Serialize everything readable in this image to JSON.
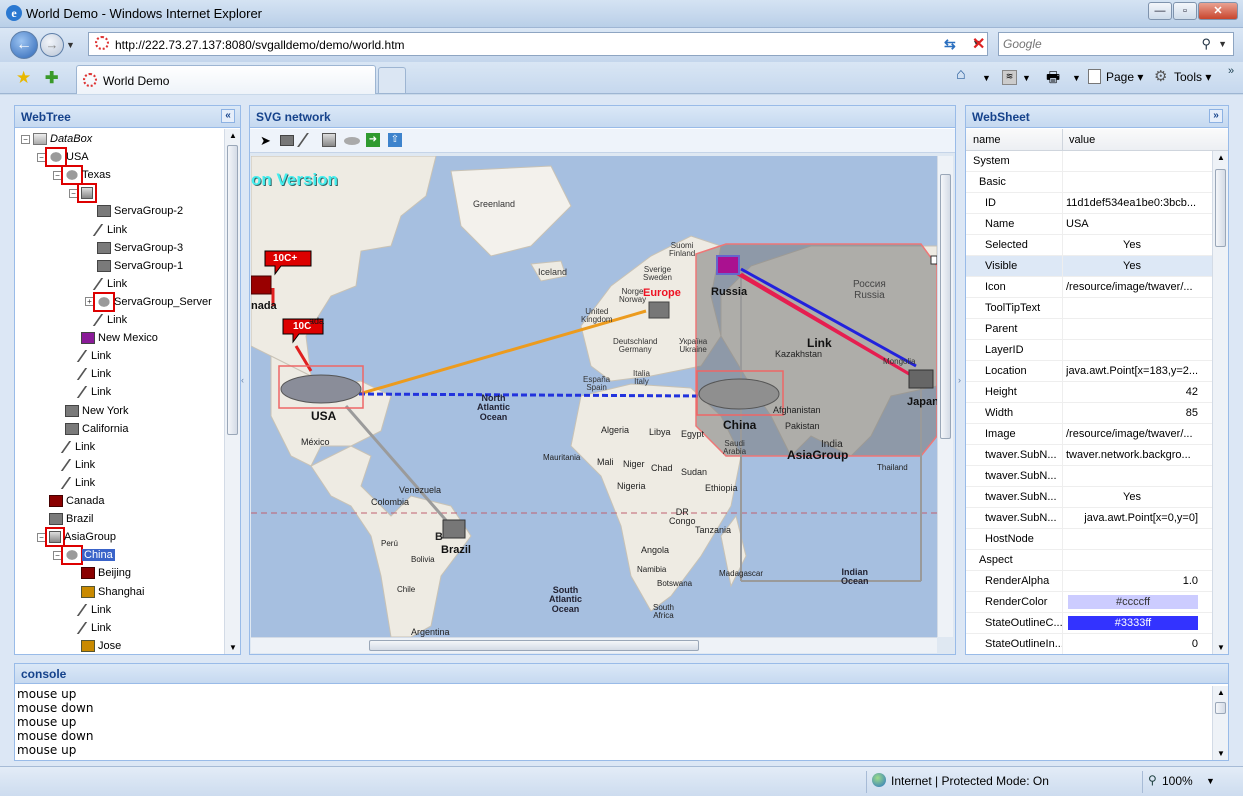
{
  "window": {
    "title": "World Demo - Windows Internet Explorer"
  },
  "nav": {
    "url": "http://222.73.27.137:8080/svgalldemo/demo/world.htm",
    "search_placeholder": "Google"
  },
  "tab": {
    "label": "World Demo"
  },
  "toolbar": {
    "page_label": "Page",
    "tools_label": "Tools"
  },
  "panels": {
    "webtree": "WebTree",
    "svg": "SVG network",
    "websheet": "WebSheet",
    "console": "console"
  },
  "tree": [
    {
      "label": "DataBox",
      "indent": 0,
      "icon": "databox-icon",
      "toggle": "−",
      "italic": true
    },
    {
      "label": "USA",
      "indent": 1,
      "icon": "cloud-icon",
      "toggle": "−",
      "red": true
    },
    {
      "label": "Texas",
      "indent": 2,
      "icon": "cloud-icon",
      "toggle": "−",
      "red": true
    },
    {
      "label": "",
      "indent": 3,
      "icon": "server-icon",
      "toggle": "−",
      "red": true
    },
    {
      "label": "ServaGroup-2",
      "indent": 4,
      "icon": "computer-icon"
    },
    {
      "label": "Link",
      "indent": 4,
      "icon": "link-icon"
    },
    {
      "label": "ServaGroup-3",
      "indent": 4,
      "icon": "computer-icon"
    },
    {
      "label": "ServaGroup-1",
      "indent": 4,
      "icon": "computer-icon"
    },
    {
      "label": "Link",
      "indent": 4,
      "icon": "link-icon"
    },
    {
      "label": "ServaGroup_Server",
      "indent": 4,
      "icon": "cloud-icon",
      "toggle": "+",
      "red": true
    },
    {
      "label": "Link",
      "indent": 4,
      "icon": "link-icon"
    },
    {
      "label": "New Mexico",
      "indent": 3,
      "icon": "purple-computer-icon"
    },
    {
      "label": "Link",
      "indent": 3,
      "icon": "link-icon"
    },
    {
      "label": "Link",
      "indent": 3,
      "icon": "link-icon"
    },
    {
      "label": "Link",
      "indent": 3,
      "icon": "link-icon"
    },
    {
      "label": "New York",
      "indent": 2,
      "icon": "computer-icon"
    },
    {
      "label": "California",
      "indent": 2,
      "icon": "computer-icon"
    },
    {
      "label": "Link",
      "indent": 2,
      "icon": "link-icon"
    },
    {
      "label": "Link",
      "indent": 2,
      "icon": "link-icon"
    },
    {
      "label": "Link",
      "indent": 2,
      "icon": "link-icon"
    },
    {
      "label": "Canada",
      "indent": 1,
      "icon": "red-computer-icon"
    },
    {
      "label": "Brazil",
      "indent": 1,
      "icon": "computer-icon"
    },
    {
      "label": "AsiaGroup",
      "indent": 1,
      "icon": "server-icon",
      "toggle": "−",
      "red": true
    },
    {
      "label": "China",
      "indent": 2,
      "icon": "cloud-icon",
      "toggle": "−",
      "red": true,
      "selected": true
    },
    {
      "label": "Beijing",
      "indent": 3,
      "icon": "red-computer-icon"
    },
    {
      "label": "Shanghai",
      "indent": 3,
      "icon": "orange-computer-icon"
    },
    {
      "label": "Link",
      "indent": 3,
      "icon": "link-icon"
    },
    {
      "label": "Link",
      "indent": 3,
      "icon": "link-icon"
    },
    {
      "label": "Jose",
      "indent": 3,
      "icon": "orange-computer-icon"
    }
  ],
  "map": {
    "watermark": "on Version",
    "labels": {
      "greenland": "Greenland",
      "iceland": "Iceland",
      "suomi": "Suomi\nFinland",
      "sverige": "Sverige\nSweden",
      "norge": "Norge\nNorway",
      "uk": "United\nKingdom",
      "deutschland": "Deutschland\nGermany",
      "ukraina": "Україна\nUkraine",
      "espana": "España\nSpain",
      "italia": "Italia\nItaly",
      "kazakhstan": "Kazakhstan",
      "mongolia": "Mongolia",
      "rossiya": "Россия\nRussia",
      "afghanistan": "Afghanistan",
      "pakistan": "Pakistan",
      "india": "India",
      "thailand": "Thailand",
      "saudi": "Saudi\nArabia",
      "egypt": "Egypt",
      "libya": "Libya",
      "algeria": "Algeria",
      "mali": "Mali",
      "niger": "Niger",
      "chad": "Chad",
      "sudan": "Sudan",
      "ethiopia": "Ethiopia",
      "mauritania": "Mauritania",
      "nigeria": "Nigeria",
      "drc": "DR\nCongo",
      "tanzania": "Tanzania",
      "angola": "Angola",
      "namibia": "Namibia",
      "botswana": "Botswana",
      "southafrica": "South\nAfrica",
      "madagascar": "Madagascar",
      "indianocean": "Indian\nOcean",
      "southatlantic": "South\nAtlantic\nOcean",
      "northatlantic": "North\nAtlantic\nOcean",
      "mexico": "México",
      "venezuela": "Venezuela",
      "colombia": "Colombia",
      "peru": "Perú",
      "bolivia": "Bolivia",
      "chile": "Chile",
      "argentina": "Argentina",
      "b": "B"
    },
    "nodes": {
      "usa": "USA",
      "china": "China",
      "russia": "Russia",
      "europe": "Europe",
      "brazil": "Brazil",
      "canada": "nada",
      "japan": "Japan",
      "asiagroup": "AsiaGroup",
      "link": "Link",
      "alarm1": "10C+",
      "alarm2": "10C",
      "ada": "ada"
    }
  },
  "sheet": {
    "col_name": "name",
    "col_value": "value",
    "rows": [
      {
        "name": "System",
        "value": "",
        "level": 0
      },
      {
        "name": "Basic",
        "value": "",
        "level": 1
      },
      {
        "name": "ID",
        "value": "11d1def534ea1be0:3bcb...",
        "level": 2
      },
      {
        "name": "Name",
        "value": "USA",
        "level": 2
      },
      {
        "name": "Selected",
        "value": "Yes",
        "level": 2,
        "center": true
      },
      {
        "name": "Visible",
        "value": "Yes",
        "level": 2,
        "center": true,
        "highlight": true
      },
      {
        "name": "Icon",
        "value": "/resource/image/twaver/...",
        "level": 2
      },
      {
        "name": "ToolTipText",
        "value": "",
        "level": 2
      },
      {
        "name": "Parent",
        "value": "",
        "level": 2
      },
      {
        "name": "LayerID",
        "value": "",
        "level": 2
      },
      {
        "name": "Location",
        "value": "java.awt.Point[x=183,y=2...",
        "level": 2
      },
      {
        "name": "Height",
        "value": "42",
        "level": 2,
        "right": true
      },
      {
        "name": "Width",
        "value": "85",
        "level": 2,
        "right": true
      },
      {
        "name": "Image",
        "value": "/resource/image/twaver/...",
        "level": 2
      },
      {
        "name": "twaver.SubN...",
        "value": "twaver.network.backgro...",
        "level": 2
      },
      {
        "name": "twaver.SubN...",
        "value": "",
        "level": 2
      },
      {
        "name": "twaver.SubN...",
        "value": "Yes",
        "level": 2,
        "center": true
      },
      {
        "name": "twaver.SubN...",
        "value": "java.awt.Point[x=0,y=0]",
        "level": 2,
        "right": true
      },
      {
        "name": "HostNode",
        "value": "",
        "level": 2
      },
      {
        "name": "Aspect",
        "value": "",
        "level": 1
      },
      {
        "name": "RenderAlpha",
        "value": "1.0",
        "level": 2,
        "right": true
      },
      {
        "name": "RenderColor",
        "value": "#ccccff",
        "level": 2,
        "swatch": "#ccccff",
        "textcolor": "#333"
      },
      {
        "name": "StateOutlineC...",
        "value": "#3333ff",
        "level": 2,
        "swatch": "#3333ff",
        "textcolor": "#fff"
      },
      {
        "name": "StateOutlineIn...",
        "value": "0",
        "level": 2,
        "right": true
      }
    ]
  },
  "console": {
    "lines": [
      "mouse up",
      "mouse down",
      "mouse up",
      "mouse down",
      "mouse up"
    ]
  },
  "status": {
    "zone": "Internet | Protected Mode: On",
    "zoom": "100%"
  }
}
